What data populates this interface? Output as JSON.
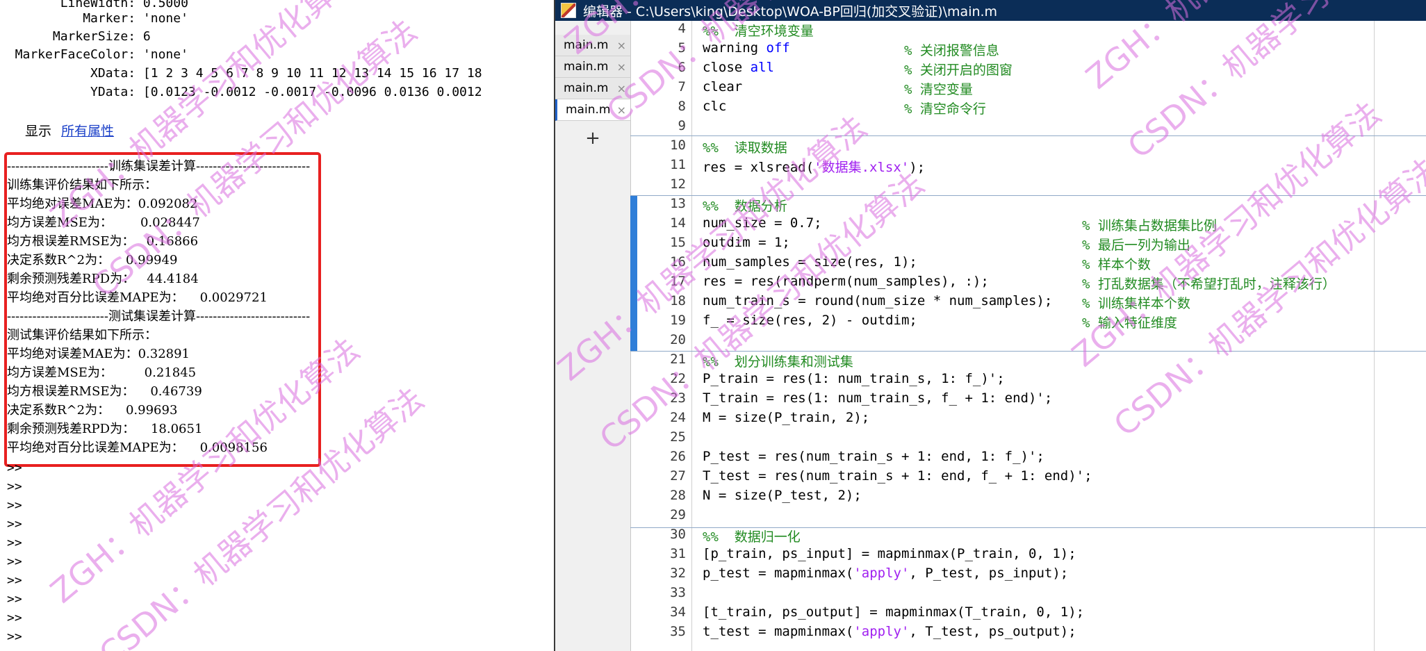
{
  "command_window": {
    "prop_lines": [
      "        LineWidth: 0.5000",
      "           Marker: 'none'",
      "       MarkerSize: 6",
      "  MarkerFaceColor: 'none'",
      "            XData: [1 2 3 4 5 6 7 8 9 10 11 12 13 14 15 16 17 18",
      "            YData: [0.0123 -0.0012 -0.0017 -0.0096 0.0136 0.0012"
    ],
    "show_label": "显示",
    "all_props_link": "所有属性",
    "results": [
      "------------------------训练集误差计算---------------------------",
      "训练集评价结果如下所示：",
      "平均绝对误差MAE为：0.092082",
      "均方误差MSE为：       0.028447",
      "均方根误差RMSE为：   0.16866",
      "决定系数R^2为：    0.99949",
      "剩余预测残差RPD为：   44.4184",
      "平均绝对百分比误差MAPE为：    0.0029721",
      "------------------------测试集误差计算---------------------------",
      "测试集评价结果如下所示：",
      "平均绝对误差MAE为：0.32891",
      "均方误差MSE为：        0.21845",
      "均方根误差RMSE为：    0.46739",
      "决定系数R^2为：    0.99693",
      "剩余预测残差RPD为：    18.0651",
      "平均绝对百分比误差MAPE为：    0.0098156"
    ],
    "prompt": ">>",
    "prompt_count": 10
  },
  "editor": {
    "title": "编辑器 - C:\\Users\\king\\Desktop\\WOA-BP回归(加交叉验证)\\main.m",
    "tabs": [
      "main.m",
      "main.m",
      "main.m",
      "main.m"
    ],
    "tab_close": "×",
    "add_tab": "+",
    "line_numbers": [
      "4",
      "5",
      "6",
      "7",
      "8",
      "9",
      "10",
      "11",
      "12",
      "13",
      "14",
      "15",
      "16",
      "17",
      "18",
      "19",
      "20",
      "21",
      "22",
      "23",
      "24",
      "25",
      "26",
      "27",
      "28",
      "29",
      "30",
      "31",
      "32",
      "33",
      "34",
      "35"
    ],
    "code": {
      "l4": "%%  清空环境变量",
      "l5a": "warning ",
      "l5b": "off",
      "l5c": "% 关闭报警信息",
      "l6a": "close ",
      "l6b": "all",
      "l6c": "% 关闭开启的图窗",
      "l7a": "clear",
      "l7c": "% 清空变量",
      "l8a": "clc",
      "l8c": "% 清空命令行",
      "l10": "%%  读取数据",
      "l11a": "res = xlsread(",
      "l11b": "'数据集.xlsx'",
      "l11c": ");",
      "l13": "%%  数据分析",
      "l14a": "num_size = 0.7;",
      "l14c": "% 训练集占数据集比例",
      "l15a": "outdim = 1;",
      "l15c": "% 最后一列为输出",
      "l16a": "num_samples = size(res, 1);",
      "l16c": "% 样本个数",
      "l17a": "res = res(randperm(num_samples), :);",
      "l17c": "% 打乱数据集（不希望打乱时，注释该行）",
      "l18a": "num_train_s = round(num_size * num_samples);",
      "l18c": "% 训练集样本个数",
      "l19a": "f_ = size(res, 2) - outdim;",
      "l19c": "% 输入特征维度",
      "l21": "%%  划分训练集和测试集",
      "l22": "P_train = res(1: num_train_s, 1: f_)';",
      "l23": "T_train = res(1: num_train_s, f_ + 1: end)';",
      "l24": "M = size(P_train, 2);",
      "l26": "P_test = res(num_train_s + 1: end, 1: f_)';",
      "l27": "T_test = res(num_train_s + 1: end, f_ + 1: end)';",
      "l28": "N = size(P_test, 2);",
      "l30": "%%  数据归一化",
      "l31": "[p_train, ps_input] = mapminmax(P_train, 0, 1);",
      "l32a": "p_test = mapminmax(",
      "l32b": "'apply'",
      "l32c": ", P_test, ps_input);",
      "l34": "[t_train, ps_output] = mapminmax(T_train, 0, 1);",
      "l35a": "t_test = mapminmax(",
      "l35b": "'apply'",
      "l35c": ", T_test, ps_output);"
    }
  },
  "watermark": {
    "text_a": "ZGH：机器学习和优化算法",
    "text_b": "CSDN：机器学习和优化算法"
  },
  "colors": {
    "keyword": "#0000ff",
    "string": "#a020f0",
    "comment": "#228b22",
    "highlight_box": "#e82020",
    "titlebar": "#0b2d57",
    "watermark": "#d96fe0"
  }
}
